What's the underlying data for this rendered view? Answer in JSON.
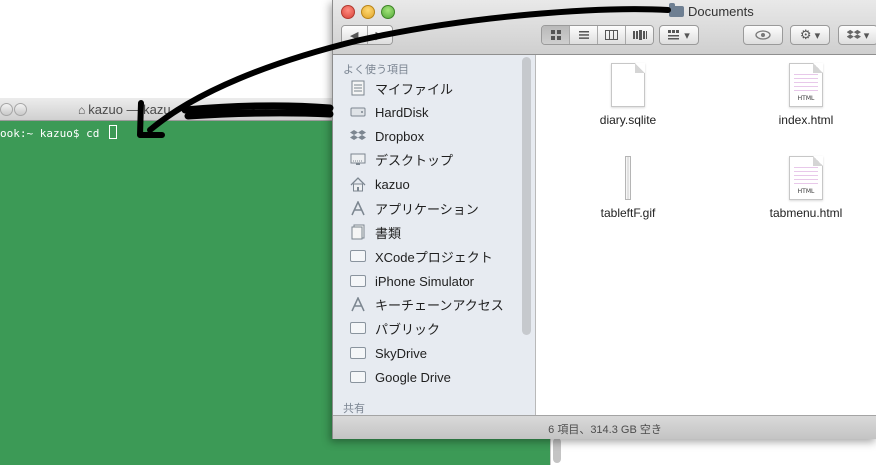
{
  "terminal": {
    "title": "kazuo — kazu",
    "prompt": "ook:~ kazuo$ cd "
  },
  "finder": {
    "title": "Documents",
    "toolbar": {
      "back": "◀",
      "forward": "▶",
      "view_modes": [
        "icon",
        "list",
        "column",
        "coverflow"
      ],
      "arrange": "▾",
      "action": "▾",
      "dropbox": "▾"
    },
    "sidebar": {
      "favorites_header": "よく使う項目",
      "items": [
        {
          "label": "マイファイル",
          "icon": "documents-icon"
        },
        {
          "label": "HardDisk",
          "icon": "harddisk-icon"
        },
        {
          "label": "Dropbox",
          "icon": "dropbox-icon"
        },
        {
          "label": "デスクトップ",
          "icon": "desktop-icon"
        },
        {
          "label": "kazuo",
          "icon": "home-icon"
        },
        {
          "label": "アプリケーション",
          "icon": "applications-icon"
        },
        {
          "label": "書類",
          "icon": "documents-folder-icon"
        },
        {
          "label": "XCodeプロジェクト",
          "icon": "folder-icon"
        },
        {
          "label": "iPhone Simulator",
          "icon": "folder-icon"
        },
        {
          "label": "キーチェーンアクセス",
          "icon": "keychain-icon"
        },
        {
          "label": "パブリック",
          "icon": "folder-icon"
        },
        {
          "label": "SkyDrive",
          "icon": "folder-icon"
        },
        {
          "label": "Google Drive",
          "icon": "folder-icon"
        }
      ],
      "shared_header": "共有"
    },
    "files": [
      {
        "name": "diary.sqlite",
        "kind": "document"
      },
      {
        "name": "index.html",
        "kind": "html",
        "tag": "HTML"
      },
      {
        "name": "tableftF.gif",
        "kind": "gif"
      },
      {
        "name": "tabmenu.html",
        "kind": "html",
        "tag": "HTML"
      }
    ],
    "status": "6 項目、314.3 GB 空き"
  },
  "colors": {
    "terminal_bg": "#3c9a56",
    "sidebar_bg": "#e7ebf1",
    "annotation": "#000000"
  }
}
